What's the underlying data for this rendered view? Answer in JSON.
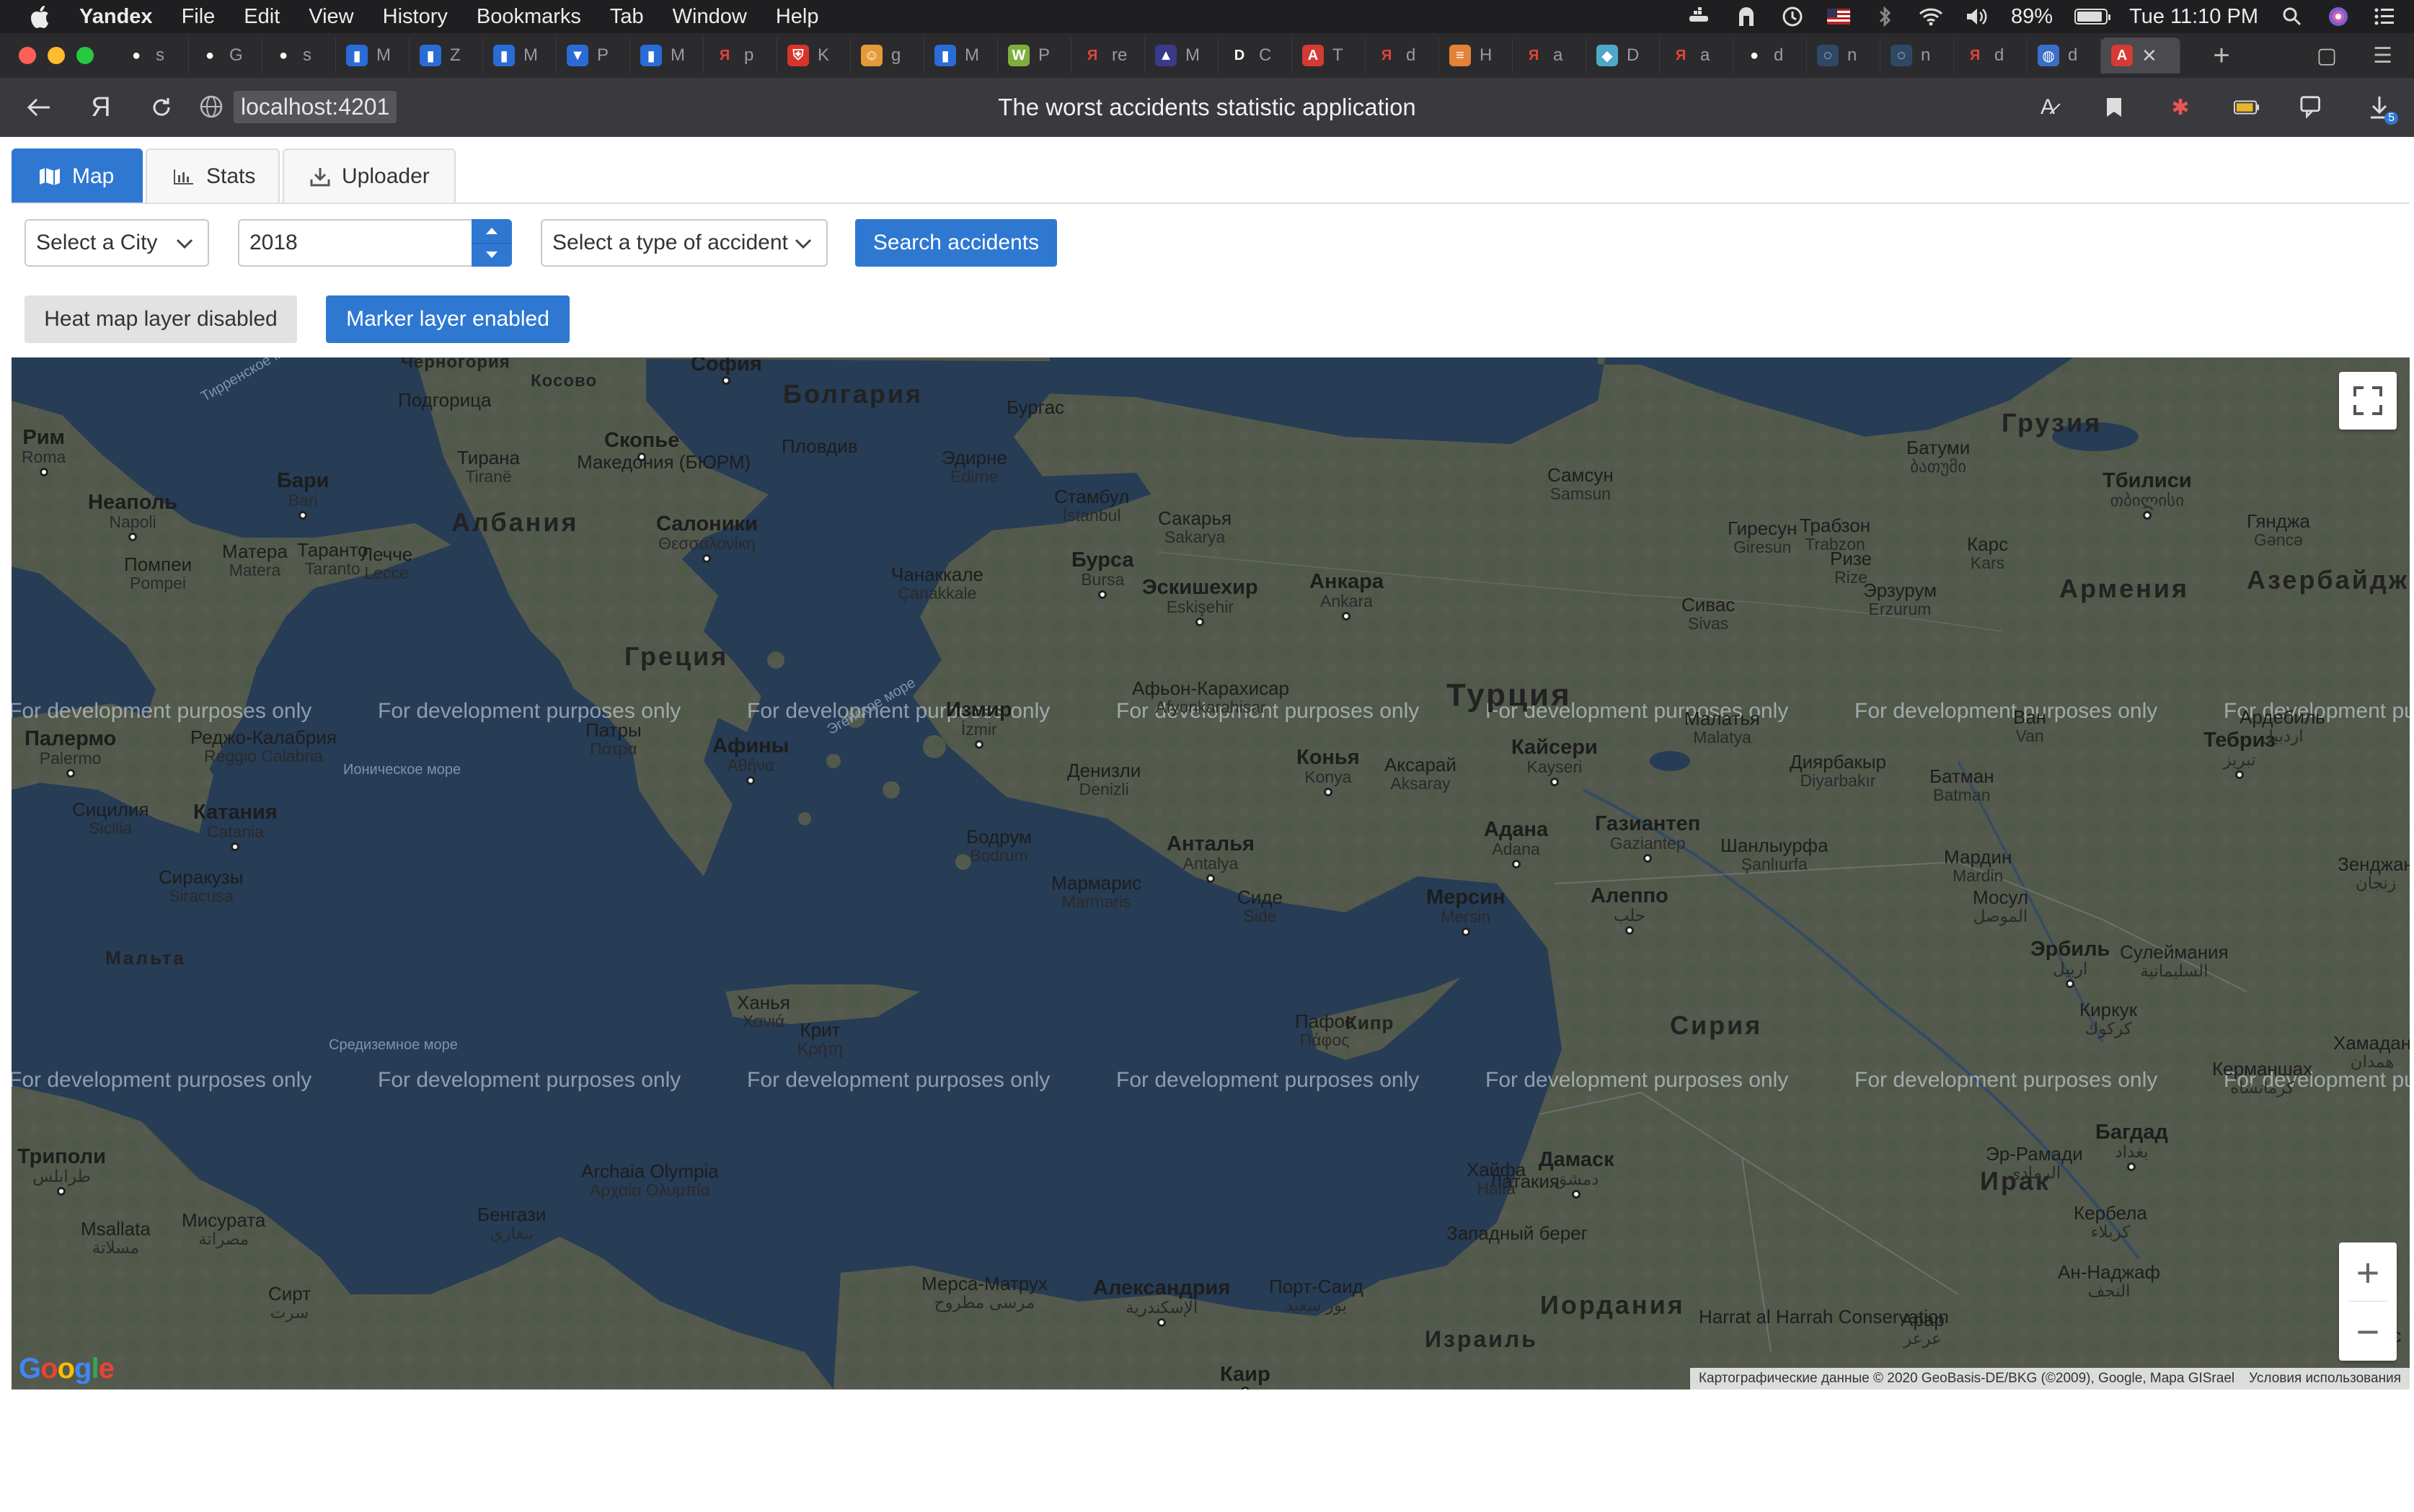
{
  "os_menubar": {
    "app_name": "Yandex",
    "items": [
      "File",
      "Edit",
      "View",
      "History",
      "Bookmarks",
      "Tab",
      "Window",
      "Help"
    ],
    "battery_percent": "89%",
    "battery_level": 0.89,
    "clock": "Tue 11:10 PM"
  },
  "browser": {
    "tabs": [
      {
        "letter": "s",
        "icon": "github-icon",
        "color": "#2b2b2e"
      },
      {
        "letter": "G",
        "icon": "github-icon",
        "color": "#2b2b2e"
      },
      {
        "letter": "s",
        "icon": "github-icon",
        "color": "#2b2b2e"
      },
      {
        "letter": "M",
        "icon": "trello-icon",
        "color": "#2a6bd6"
      },
      {
        "letter": "Z",
        "icon": "trello-icon",
        "color": "#2a6bd6"
      },
      {
        "letter": "M",
        "icon": "trello-icon",
        "color": "#2a6bd6"
      },
      {
        "letter": "P",
        "icon": "bitbucket-icon",
        "color": "#2a6bd6"
      },
      {
        "letter": "M",
        "icon": "trello-icon",
        "color": "#2a6bd6"
      },
      {
        "letter": "p",
        "icon": "yandex-icon",
        "color": "#e64338"
      },
      {
        "letter": "K",
        "icon": "shield-icon",
        "color": "#d8342a"
      },
      {
        "letter": "g",
        "icon": "user-icon",
        "color": "#e59a3a"
      },
      {
        "letter": "M",
        "icon": "trello-icon",
        "color": "#2a6bd6"
      },
      {
        "letter": "P",
        "icon": "w-icon",
        "color": "#7fae3d"
      },
      {
        "letter": "re",
        "icon": "yandex-icon",
        "color": "#e64338"
      },
      {
        "letter": "M",
        "icon": "triangle-icon",
        "color": "#3a3a8a"
      },
      {
        "letter": "C",
        "icon": "d-icon",
        "color": "#2b2b2e"
      },
      {
        "letter": "T",
        "icon": "angular-icon",
        "color": "#d63a34"
      },
      {
        "letter": "d",
        "icon": "yandex-icon",
        "color": "#e64338"
      },
      {
        "letter": "H",
        "icon": "stack-icon",
        "color": "#e5823a"
      },
      {
        "letter": "a",
        "icon": "yandex-icon",
        "color": "#e64338"
      },
      {
        "letter": "D",
        "icon": "cube-icon",
        "color": "#4fa8c8"
      },
      {
        "letter": "a",
        "icon": "yandex-icon",
        "color": "#e64338"
      },
      {
        "letter": "d",
        "icon": "github-icon",
        "color": "#2b2b2e"
      },
      {
        "letter": "n",
        "icon": "circle-icon",
        "color": "#2f4866"
      },
      {
        "letter": "n",
        "icon": "circle-icon",
        "color": "#2f4866"
      },
      {
        "letter": "d",
        "icon": "yandex-icon",
        "color": "#e64338"
      },
      {
        "letter": "d",
        "icon": "globe-icon",
        "color": "#3a6ec8"
      }
    ],
    "active_tab_icon": "angular-icon",
    "url": "localhost:4201",
    "page_title": "The worst accidents statistic application",
    "download_badge": "5"
  },
  "app": {
    "tabs": [
      {
        "label": "Map",
        "icon": "map-icon",
        "active": true
      },
      {
        "label": "Stats",
        "icon": "bar-chart-icon",
        "active": false
      },
      {
        "label": "Uploader",
        "icon": "download-icon",
        "active": false
      }
    ],
    "filters": {
      "city_placeholder": "Select a City",
      "year_value": "2018",
      "accident_type_placeholder": "Select a type of accident",
      "search_label": "Search accidents"
    },
    "layers": {
      "heatmap_label": "Heat map layer disabled",
      "marker_label": "Marker layer enabled"
    }
  },
  "map": {
    "watermark_text": "For development purposes only",
    "attribution": "Картографические данные © 2020 GeoBasis-DE/BKG (©2009), Google, Mapa GISrael",
    "terms": "Условия использования",
    "logo": "Google",
    "zoom_in": "+",
    "zoom_out": "−",
    "countries": [
      "Черногория",
      "Косово",
      "Болгария",
      "Грузия",
      "Албания",
      "Греция",
      "Турция",
      "Армения",
      "Азербайдж",
      "Сирия",
      "Ирак",
      "Мальта",
      "Иордания",
      "Израиль",
      "Кипр"
    ],
    "cities": [
      {
        "ru": "София",
        "local": ""
      },
      {
        "ru": "Подгорица",
        "local": ""
      },
      {
        "ru": "Скопье",
        "local": ""
      },
      {
        "ru": "Македония (БЮРМ)",
        "local": ""
      },
      {
        "ru": "Тирана",
        "local": "Tiranë"
      },
      {
        "ru": "Пловдив",
        "local": ""
      },
      {
        "ru": "Бургас",
        "local": ""
      },
      {
        "ru": "Эдирне",
        "local": "Edirne"
      },
      {
        "ru": "Стамбул",
        "local": "İstanbul"
      },
      {
        "ru": "Самсун",
        "local": "Samsun"
      },
      {
        "ru": "Батуми",
        "local": "ბათუმი"
      },
      {
        "ru": "Тбилиси",
        "local": "თბილისი"
      },
      {
        "ru": "Рим",
        "local": "Roma"
      },
      {
        "ru": "Бари",
        "local": "Bari"
      },
      {
        "ru": "Неаполь",
        "local": "Napoli"
      },
      {
        "ru": "Салоники",
        "local": "Θεσσαλονίκη"
      },
      {
        "ru": "Сакарья",
        "local": "Sakarya"
      },
      {
        "ru": "Гиресун",
        "local": "Giresun"
      },
      {
        "ru": "Трабзон",
        "local": "Trabzon"
      },
      {
        "ru": "Ризе",
        "local": "Rize"
      },
      {
        "ru": "Карс",
        "local": "Kars"
      },
      {
        "ru": "Гянджа",
        "local": "Gəncə"
      },
      {
        "ru": "Бурса",
        "local": "Bursa"
      },
      {
        "ru": "Эскишехир",
        "local": "Eskişehir"
      },
      {
        "ru": "Анкара",
        "local": "Ankara"
      },
      {
        "ru": "Сивас",
        "local": "Sivas"
      },
      {
        "ru": "Эрзурум",
        "local": "Erzurum"
      },
      {
        "ru": "Матера",
        "local": "Matera"
      },
      {
        "ru": "Таранто",
        "local": "Taranto"
      },
      {
        "ru": "Лечче",
        "local": "Lecce"
      },
      {
        "ru": "Помпеи",
        "local": "Pompei"
      },
      {
        "ru": "Чанаккале",
        "local": "Çanakkale"
      },
      {
        "ru": "Афьон-Карахисар",
        "local": "Afyonkarahisar"
      },
      {
        "ru": "Измир",
        "local": "İzmir"
      },
      {
        "ru": "Малатья",
        "local": "Malatya"
      },
      {
        "ru": "Ван",
        "local": "Van"
      },
      {
        "ru": "Тебриз",
        "local": "تبریز"
      },
      {
        "ru": "Ардебиль",
        "local": "اردبیل"
      },
      {
        "ru": "Палермо",
        "local": "Palermo"
      },
      {
        "ru": "Реджо-Калабрия",
        "local": "Reggio Calabria"
      },
      {
        "ru": "Патры",
        "local": "Πάτρα"
      },
      {
        "ru": "Афины",
        "local": "Αθήνα"
      },
      {
        "ru": "Денизли",
        "local": "Denizli"
      },
      {
        "ru": "Конья",
        "local": "Konya"
      },
      {
        "ru": "Аксарай",
        "local": "Aksaray"
      },
      {
        "ru": "Кайсери",
        "local": "Kayseri"
      },
      {
        "ru": "Диярбакыр",
        "local": "Diyarbakır"
      },
      {
        "ru": "Батман",
        "local": "Batman"
      },
      {
        "ru": "Сицилия",
        "local": "Sicilia"
      },
      {
        "ru": "Катания",
        "local": "Catania"
      },
      {
        "ru": "Бодрум",
        "local": "Bodrum"
      },
      {
        "ru": "Анталья",
        "local": "Antalya"
      },
      {
        "ru": "Адана",
        "local": "Adana"
      },
      {
        "ru": "Газиантеп",
        "local": "Gaziantep"
      },
      {
        "ru": "Шанлыурфа",
        "local": "Şanlıurfa"
      },
      {
        "ru": "Мардин",
        "local": "Mardin"
      },
      {
        "ru": "Зенджан",
        "local": "زنجان"
      },
      {
        "ru": "Сиракузы",
        "local": "Siracusa"
      },
      {
        "ru": "Мармарис",
        "local": "Marmaris"
      },
      {
        "ru": "Сиде",
        "local": "Side"
      },
      {
        "ru": "Мерсин",
        "local": "Mersin"
      },
      {
        "ru": "Алеппо",
        "local": "حلب"
      },
      {
        "ru": "Мосул",
        "local": "الموصل"
      },
      {
        "ru": "Эрбиль",
        "local": "اربيل"
      },
      {
        "ru": "Сулеймания",
        "local": "السليمانية"
      },
      {
        "ru": "Ханья",
        "local": "Χανιά"
      },
      {
        "ru": "Крит",
        "local": "Κρήτη"
      },
      {
        "ru": "Пафос",
        "local": "Πάφος"
      },
      {
        "ru": "Киркук",
        "local": "كركوك"
      },
      {
        "ru": "Хамадан",
        "local": "همدان"
      },
      {
        "ru": "Керманшах",
        "local": "کرمانشاه"
      },
      {
        "ru": "Триполи",
        "local": "طرابلس"
      },
      {
        "ru": "Латакия",
        "local": ""
      },
      {
        "ru": "Дамаск",
        "local": "دمشق"
      },
      {
        "ru": "Хайфа",
        "local": "Haifa"
      },
      {
        "ru": "Багдад",
        "local": "بغداد"
      },
      {
        "ru": "Эр-Рамади",
        "local": "الرمادي"
      },
      {
        "ru": "Кербела",
        "local": "كربلاء"
      },
      {
        "ru": "Мисурата",
        "local": "مصراتة"
      },
      {
        "ru": "Бенгази",
        "local": "بنغازي"
      },
      {
        "ru": "Сирт",
        "local": "سرت"
      },
      {
        "ru": "Мерса-Матрух",
        "local": "مرسى مطروح"
      },
      {
        "ru": "Александрия",
        "local": "الإسكندرية"
      },
      {
        "ru": "Порт-Саид",
        "local": "بور سعيد"
      },
      {
        "ru": "Западный берег",
        "local": ""
      },
      {
        "ru": "Ан-Наджаф",
        "local": "النجف"
      },
      {
        "ru": "Арар",
        "local": "عرعر"
      },
      {
        "ru": "Каир",
        "local": ""
      },
      {
        "ru": "Бас",
        "local": ""
      },
      {
        "ru": "Harrat al Harrah Conservation",
        "local": ""
      },
      {
        "ru": "Msallata",
        "local": "مسلاتة"
      },
      {
        "ru": "Archaia Olympia",
        "local": "Αρχαία Ολυμπία"
      },
      {
        "ru": "Средиземное море",
        "local": ""
      },
      {
        "ru": "Ионическое море",
        "local": ""
      },
      {
        "ru": "Тирренское море",
        "local": ""
      },
      {
        "ru": "Эгейское море",
        "local": ""
      }
    ]
  }
}
